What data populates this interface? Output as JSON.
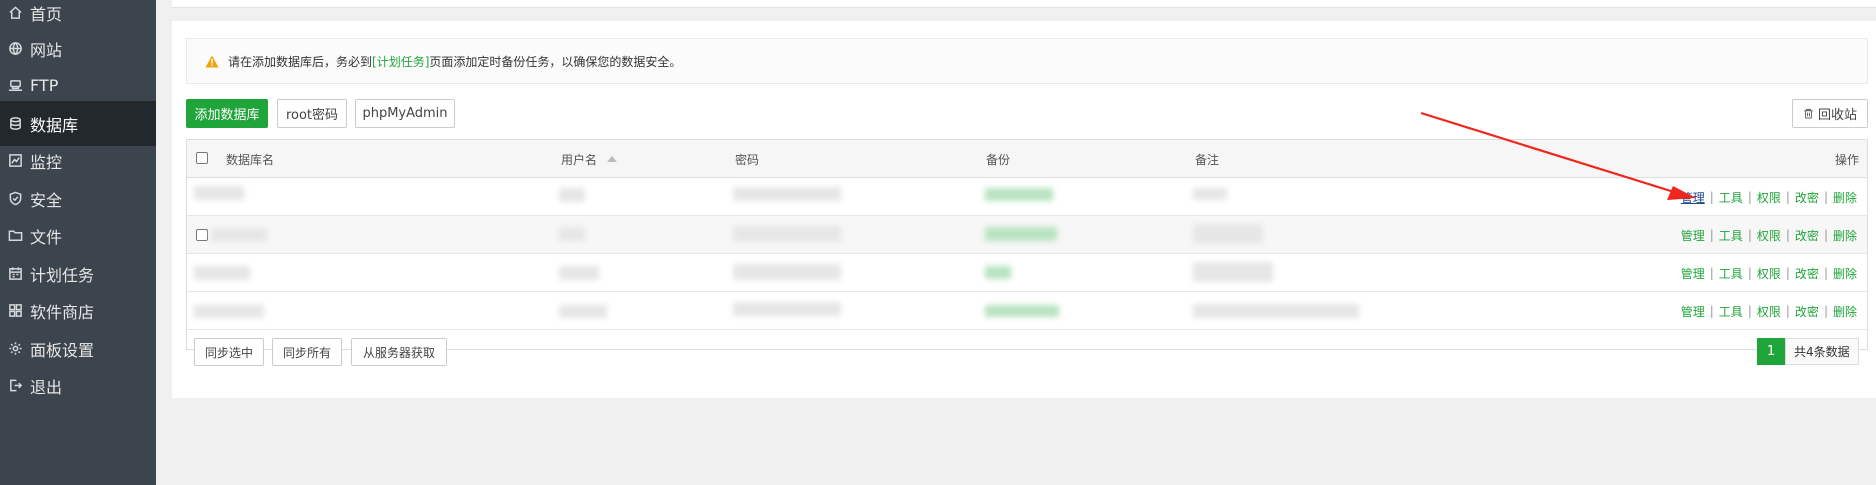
{
  "sidebar": {
    "items": [
      {
        "label": "首页",
        "icon": "home-icon",
        "active": false
      },
      {
        "label": "网站",
        "icon": "globe-icon",
        "active": false
      },
      {
        "label": "FTP",
        "icon": "ftp-icon",
        "active": false
      },
      {
        "label": "数据库",
        "icon": "database-icon",
        "active": true
      },
      {
        "label": "监控",
        "icon": "monitor-icon",
        "active": false
      },
      {
        "label": "安全",
        "icon": "shield-icon",
        "active": false
      },
      {
        "label": "文件",
        "icon": "folder-icon",
        "active": false
      },
      {
        "label": "计划任务",
        "icon": "calendar-icon",
        "active": false
      },
      {
        "label": "软件商店",
        "icon": "grid-icon",
        "active": false
      },
      {
        "label": "面板设置",
        "icon": "gear-icon",
        "active": false
      },
      {
        "label": "退出",
        "icon": "logout-icon",
        "active": false
      }
    ]
  },
  "alert": {
    "text_before": "请在添加数据库后，务必到",
    "link": "[计划任务]",
    "text_after": "页面添加定时备份任务，以确保您的数据安全。"
  },
  "toolbar": {
    "add_database": "添加数据库",
    "root_password": "root密码",
    "phpmyadmin": "phpMyAdmin",
    "recycle_bin": "回收站"
  },
  "table": {
    "headers": {
      "name": "数据库名",
      "username": "用户名",
      "password": "密码",
      "backup": "备份",
      "remark": "备注",
      "actions": "操作"
    },
    "row_actions": [
      "管理",
      "工具",
      "权限",
      "改密",
      "删除"
    ],
    "separator": "|"
  },
  "footer": {
    "sync_selected": "同步选中",
    "sync_all": "同步所有",
    "fetch_from_server": "从服务器获取"
  },
  "pager": {
    "current_page": "1",
    "total": "共4条数据"
  },
  "colors": {
    "sidebar_bg": "#3c444d",
    "sidebar_active": "#23282d",
    "accent_green": "#20a53a",
    "arrow_red": "#f0261e"
  }
}
